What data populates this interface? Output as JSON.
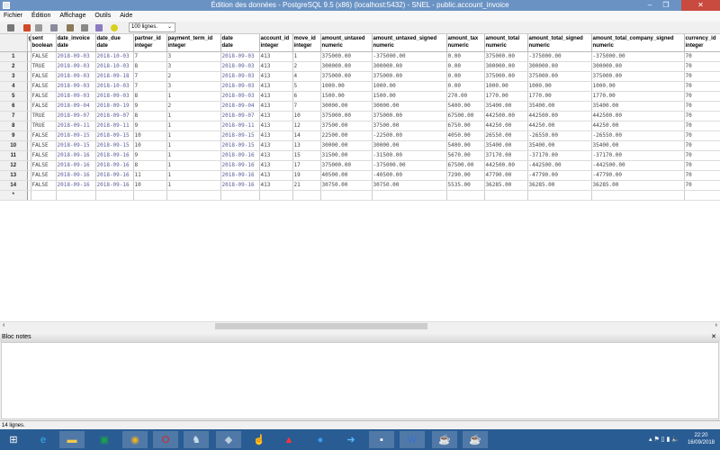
{
  "window": {
    "title": "Édition des données - PostgreSQL 9.5 (x86) (localhost:5432) - SNEL - public.account_invoice",
    "minimize": "‒",
    "restore": "❐",
    "close": "✕"
  },
  "menu": [
    "Fichier",
    "Édition",
    "Affichage",
    "Outils",
    "Aide"
  ],
  "toolbar": {
    "limit": "100 lignes.",
    "limit_arrow": "⌄"
  },
  "columns": [
    {
      "name": "g",
      "type": ""
    },
    {
      "name": "sent",
      "type": "boolean"
    },
    {
      "name": "date_invoice",
      "type": "date"
    },
    {
      "name": "date_due",
      "type": "date"
    },
    {
      "name": "partner_id",
      "type": "integer"
    },
    {
      "name": "payment_term_id",
      "type": "integer"
    },
    {
      "name": "date",
      "type": "date"
    },
    {
      "name": "account_id",
      "type": "integer"
    },
    {
      "name": "move_id",
      "type": "integer"
    },
    {
      "name": "amount_untaxed",
      "type": "numeric"
    },
    {
      "name": "amount_untaxed_signed",
      "type": "numeric"
    },
    {
      "name": "amount_tax",
      "type": "numeric"
    },
    {
      "name": "amount_total",
      "type": "numeric"
    },
    {
      "name": "amount_total_signed",
      "type": "numeric"
    },
    {
      "name": "amount_total_company_signed",
      "type": "numeric"
    },
    {
      "name": "currency_id",
      "type": "integer"
    }
  ],
  "rows": [
    [
      "1",
      "",
      "FALSE",
      "2018-09-03",
      "2018-10-03",
      "7",
      "3",
      "2018-09-03",
      "413",
      "1",
      "375000.00",
      "-375000.00",
      "0.00",
      "375000.00",
      "-375000.00",
      "-375000.00",
      "70"
    ],
    [
      "2",
      "",
      "TRUE",
      "2018-09-03",
      "2018-10-03",
      "8",
      "3",
      "2018-09-03",
      "413",
      "2",
      "300000.00",
      "300000.00",
      "0.00",
      "300000.00",
      "300000.00",
      "300000.00",
      "70"
    ],
    [
      "3",
      "",
      "FALSE",
      "2018-09-03",
      "2018-09-18",
      "7",
      "2",
      "2018-09-03",
      "413",
      "4",
      "375000.00",
      "375000.00",
      "0.00",
      "375000.00",
      "375000.00",
      "375000.00",
      "70"
    ],
    [
      "4",
      "",
      "FALSE",
      "2018-09-03",
      "2018-10-03",
      "7",
      "3",
      "2018-09-03",
      "413",
      "5",
      "1000.00",
      "1000.00",
      "0.00",
      "1000.00",
      "1000.00",
      "1000.00",
      "70"
    ],
    [
      "5",
      "",
      "FALSE",
      "2018-09-03",
      "2018-09-03",
      "8",
      "1",
      "2018-09-03",
      "413",
      "6",
      "1500.00",
      "1500.00",
      "270.00",
      "1770.00",
      "1770.00",
      "1770.00",
      "70"
    ],
    [
      "6",
      "",
      "FALSE",
      "2018-09-04",
      "2018-09-19",
      "9",
      "2",
      "2018-09-04",
      "413",
      "7",
      "30000.00",
      "30000.00",
      "5400.00",
      "35400.00",
      "35400.00",
      "35400.00",
      "70"
    ],
    [
      "7",
      "",
      "TRUE",
      "2018-09-07",
      "2018-09-07",
      "8",
      "1",
      "2018-09-07",
      "413",
      "10",
      "375000.00",
      "375000.00",
      "67500.00",
      "442500.00",
      "442500.00",
      "442500.00",
      "70"
    ],
    [
      "8",
      "",
      "TRUE",
      "2018-09-11",
      "2018-09-11",
      "9",
      "1",
      "2018-09-11",
      "413",
      "12",
      "37500.00",
      "37500.00",
      "6750.00",
      "44250.00",
      "44250.00",
      "44250.00",
      "70"
    ],
    [
      "9",
      "",
      "FALSE",
      "2018-09-15",
      "2018-09-15",
      "10",
      "1",
      "2018-09-15",
      "413",
      "14",
      "22500.00",
      "-22500.00",
      "4050.00",
      "26550.00",
      "-26550.00",
      "-26550.00",
      "70"
    ],
    [
      "10",
      "",
      "FALSE",
      "2018-09-15",
      "2018-09-15",
      "10",
      "1",
      "2018-09-15",
      "413",
      "13",
      "30000.00",
      "30000.00",
      "5400.00",
      "35400.00",
      "35400.00",
      "35400.00",
      "70"
    ],
    [
      "11",
      "",
      "FALSE",
      "2018-09-16",
      "2018-09-16",
      "9",
      "1",
      "2018-09-16",
      "413",
      "15",
      "31500.00",
      "-31500.00",
      "5670.00",
      "37170.00",
      "-37170.00",
      "-37170.00",
      "70"
    ],
    [
      "12",
      "",
      "FALSE",
      "2018-09-16",
      "2018-09-16",
      "8",
      "1",
      "2018-09-16",
      "413",
      "17",
      "375000.00",
      "-375000.00",
      "67500.00",
      "442500.00",
      "-442500.00",
      "-442500.00",
      "70"
    ],
    [
      "13",
      "",
      "FALSE",
      "2018-09-16",
      "2018-09-16",
      "11",
      "1",
      "2018-09-16",
      "413",
      "19",
      "40500.00",
      "-40500.00",
      "7290.00",
      "47790.00",
      "-47790.00",
      "-47790.00",
      "70"
    ],
    [
      "14",
      "",
      "FALSE",
      "2018-09-16",
      "2018-09-16",
      "10",
      "1",
      "2018-09-16",
      "413",
      "21",
      "30750.00",
      "30750.00",
      "5535.00",
      "36285.00",
      "36285.00",
      "36285.00",
      "70"
    ]
  ],
  "new_row_marker": "*",
  "scroll": {
    "left": "‹",
    "right": "›"
  },
  "notes": {
    "title": "Bloc notes",
    "close": "✕"
  },
  "status": "14 lignes.",
  "taskbar": {
    "time": "22:20",
    "date": "16/09/2018"
  }
}
